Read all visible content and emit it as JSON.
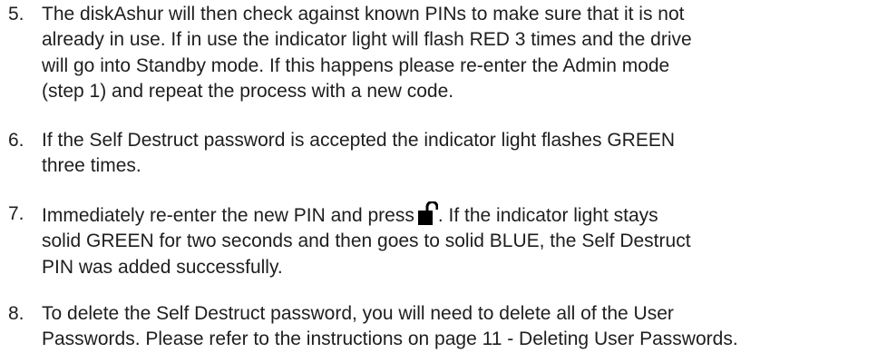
{
  "steps": [
    {
      "number": "5.",
      "lines": [
        "The diskAshur will then check against known PINs to make sure that it is not",
        "already in use. If in use the indicator light will flash RED 3 times and the drive",
        "will go into Standby mode. If this happens please re-enter the Admin mode",
        "(step 1) and repeat the process with a new code."
      ]
    },
    {
      "number": "6.",
      "lines": [
        "If the Self Destruct password is accepted the indicator light flashes GREEN",
        "three times."
      ]
    },
    {
      "number": "7.",
      "line1_before_icon": "Immediately re-enter the new PIN and press",
      "line1_after_icon": ". If the indicator light stays",
      "icon": "unlock-icon",
      "lines_rest": [
        "solid GREEN for two seconds and then goes to solid BLUE, the Self Destruct",
        "PIN was added successfully."
      ]
    },
    {
      "number": "8.",
      "lines": [
        "To delete the Self Destruct password, you will need to delete all of the User",
        "Passwords. Please refer to the instructions on page 11 - Deleting User Passwords."
      ]
    }
  ]
}
